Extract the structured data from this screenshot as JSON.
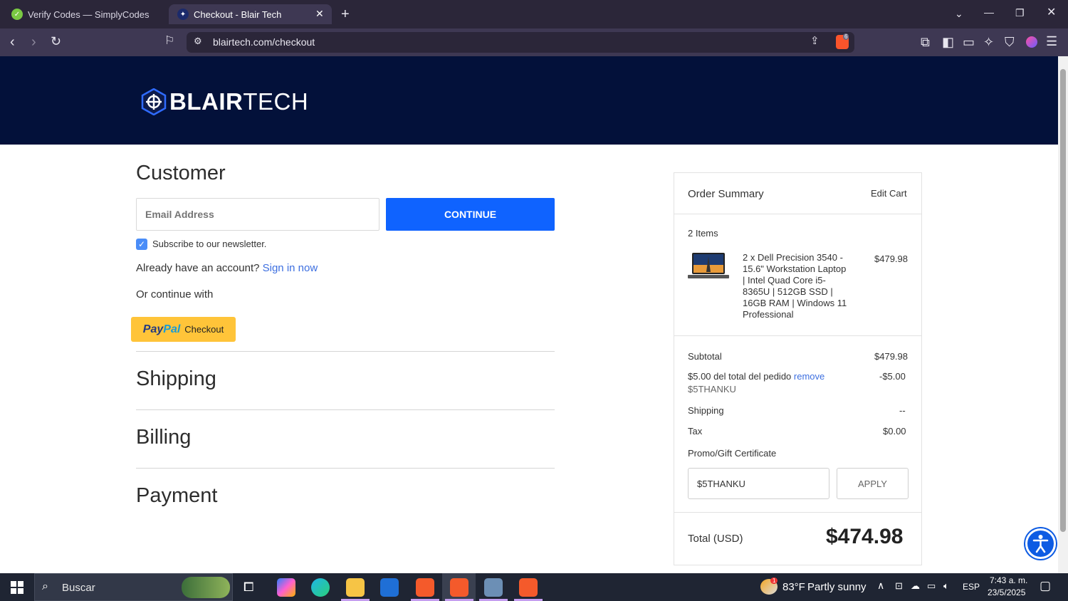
{
  "browser": {
    "tabs": [
      {
        "title": "Verify Codes — SimplyCodes",
        "active": false
      },
      {
        "title": "Checkout - Blair Tech",
        "active": true
      }
    ],
    "url": "blairtech.com/checkout",
    "brave_badge": "6"
  },
  "site": {
    "logo_bold": "BLAIR",
    "logo_thin": "TECH"
  },
  "customer": {
    "heading": "Customer",
    "email_placeholder": "Email Address",
    "continue_label": "CONTINUE",
    "newsletter_label": "Subscribe to our newsletter.",
    "newsletter_checked": true,
    "account_prompt": "Already have an account?",
    "sign_in_label": "Sign in now",
    "or_continue": "Or continue with",
    "paypal_label_1": "Pay",
    "paypal_label_2": "Pal",
    "paypal_label_3": "Checkout"
  },
  "sections": {
    "shipping": "Shipping",
    "billing": "Billing",
    "payment": "Payment"
  },
  "summary": {
    "title": "Order Summary",
    "edit_cart": "Edit Cart",
    "items_count": "2 Items",
    "item_lines": [
      "2 x Dell Precision 3540 -",
      "15.6\" Workstation Laptop",
      "| Intel Quad Core i5-",
      "8365U | 512GB SSD |",
      "16GB RAM | Windows 11",
      "Professional"
    ],
    "item_price": "$479.98",
    "subtotal_label": "Subtotal",
    "subtotal_value": "$479.98",
    "discount_label": "$5.00 del total del pedido",
    "discount_remove": "remove",
    "discount_code": "$5THANKU",
    "discount_value": "-$5.00",
    "shipping_label": "Shipping",
    "shipping_value": "--",
    "tax_label": "Tax",
    "tax_value": "$0.00",
    "promo_label": "Promo/Gift Certificate",
    "promo_value": "$5THANKU",
    "apply_label": "APPLY",
    "total_label": "Total (USD)",
    "total_value": "$474.98"
  },
  "taskbar": {
    "search_placeholder": "Buscar",
    "weather_temp": "83°F",
    "weather_desc": "Partly sunny",
    "weather_badge": "1",
    "language": "ESP",
    "time": "7:43 a. m.",
    "date": "23/5/2025"
  },
  "colors": {
    "header_bg": "#03113a",
    "primary_button": "#0f63ff",
    "link": "#3d6fe0",
    "paypal_yellow": "#ffc439"
  }
}
